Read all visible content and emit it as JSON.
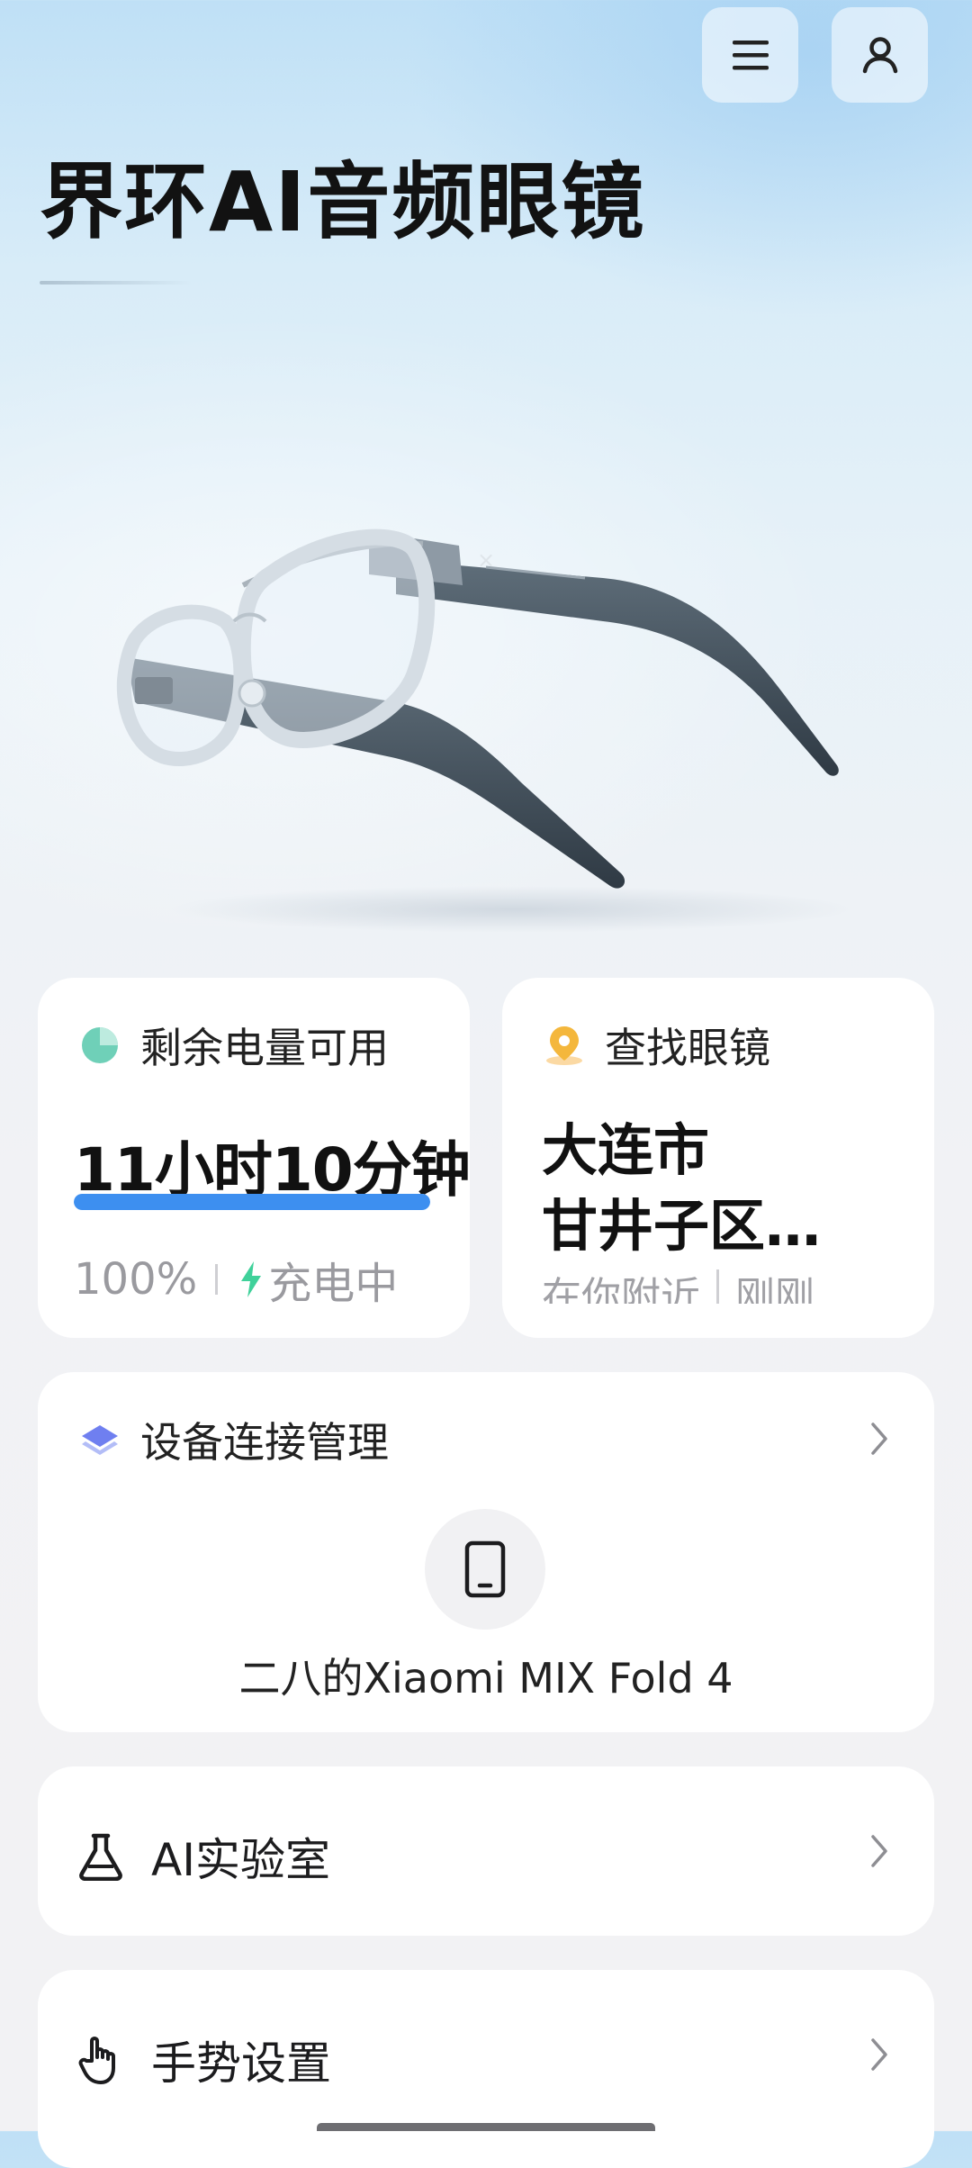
{
  "header": {
    "title": "界环AI音频眼镜",
    "menu_icon": "menu-icon",
    "profile_icon": "user-icon"
  },
  "battery_card": {
    "label": "剩余电量可用",
    "icon": "pie-chart-icon",
    "remaining_time": "11小时10分钟",
    "level_percent": 100,
    "percent_text": "100%",
    "charging_text": "充电中",
    "accent_color": "#3d8ff0",
    "icon_color": "#6fd0b8"
  },
  "find_card": {
    "label": "查找眼镜",
    "icon": "location-pin-icon",
    "location_line1": "大连市",
    "location_line2": "甘井子区…",
    "nearby_text": "在你附近",
    "time_text": "刚刚",
    "icon_color": "#f4b73c"
  },
  "device_card": {
    "label": "设备连接管理",
    "icon": "layers-icon",
    "device_icon": "phone-icon",
    "device_name": "二八的Xiaomi MIX Fold 4",
    "icon_color": "#6f7ff0"
  },
  "ai_lab": {
    "label": "AI实验室",
    "icon": "flask-icon"
  },
  "gesture": {
    "label": "手势设置",
    "icon": "hand-pointer-icon"
  }
}
